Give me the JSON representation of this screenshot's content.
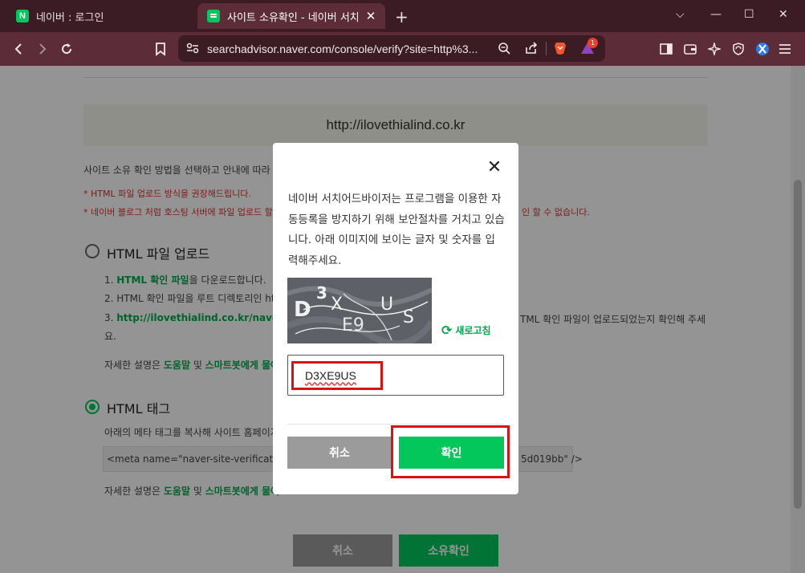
{
  "browser": {
    "tabs": [
      {
        "title": "네이버 : 로그인",
        "favicon": "N"
      },
      {
        "title": "사이트 소유확인 - 네이버 서치",
        "close": "✕"
      }
    ],
    "new_tab": "+",
    "url": "searchadvisor.naver.com/console/verify?site=http%3...",
    "brave_badge": "1"
  },
  "page": {
    "site_url": "http://ilovethialind.co.kr",
    "intro": "사이트 소유 확인 방법을 선택하고 안내에 따라 ",
    "note1": "* HTML 파일 업로드 방식을 권장해드립니다.",
    "note2a": "* 네이버 블로그 처럼 호스팅 서버에 파일 업로드 할",
    "note2b": "인 할 수 없습니다.",
    "option_file": "HTML 파일 업로드",
    "step1_link": "HTML 확인 파일",
    "step1_rest": "을 다운로드합니다.",
    "step2": "2. HTML 확인 파일을 루트 디렉토리인 ht",
    "step3_link": "http://ilovethialind.co.kr/naverbf3",
    "step3_rest": "TML 확인 파일이 업로드되었는지 확인해 주세",
    "step3_cont": "요.",
    "detail_prefix": "자세한 설명은 ",
    "help": "도움말",
    "and": " 및 ",
    "smartbot": "스마트봇에게 물어",
    "option_tag": "HTML 태그",
    "tag_desc": "아래의 메타 태그를 복사해 사이트 홈페이지",
    "meta_a": "<meta name=\"naver-site-verificatio",
    "meta_b": "5d019bb\" />",
    "cancel": "취소",
    "verify": "소유확인"
  },
  "modal": {
    "close": "✕",
    "description": "네이버 서치어드바이저는 프로그램을 이용한 자동등록을 방지하기 위해 보안절차를 거치고 있습니다. 아래 이미지에 보이는 글자 및 숫자를 입력해주세요.",
    "refresh_label": "새로고침",
    "captcha_value": "D3XE9US",
    "cancel_label": "취소",
    "confirm_label": "확인"
  },
  "colors": {
    "naver_green": "#03c75a",
    "highlight_red": "#e01010",
    "tab_bg": "#3b1c24"
  }
}
